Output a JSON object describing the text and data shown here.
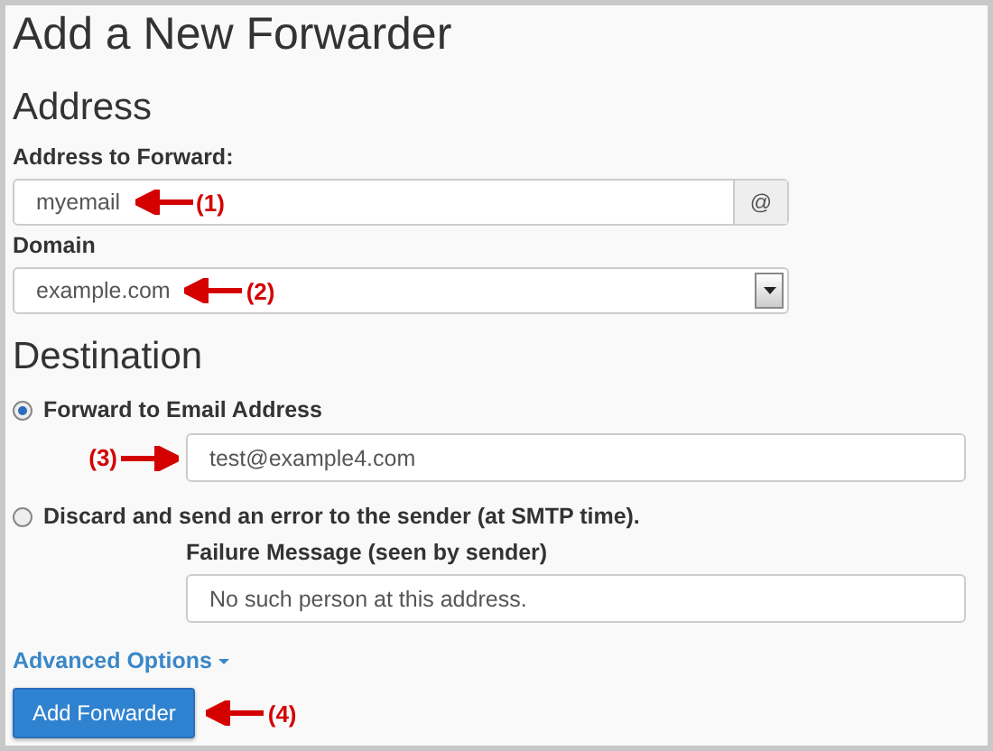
{
  "title": "Add a New Forwarder",
  "address": {
    "heading": "Address",
    "forward_label": "Address to Forward:",
    "forward_value": "myemail",
    "addon": "@",
    "forward_callout": {
      "label": "(1)",
      "kind": "left"
    },
    "domain_label": "Domain",
    "domain_value": "example.com",
    "domain_callout": {
      "label": "(2)",
      "kind": "left"
    }
  },
  "destination": {
    "heading": "Destination",
    "options": [
      {
        "label": "Forward to Email Address",
        "selected": true,
        "field_value": "test@example4.com",
        "callout": {
          "label": "(3)",
          "kind": "right"
        }
      },
      {
        "label": "Discard and send an error to the sender (at SMTP time).",
        "selected": false,
        "field_label": "Failure Message (seen by sender)",
        "field_value": "No such person at this address."
      }
    ]
  },
  "advanced_link": "Advanced Options",
  "submit": {
    "label": "Add Forwarder",
    "callout": {
      "label": "(4)",
      "kind": "left"
    }
  }
}
